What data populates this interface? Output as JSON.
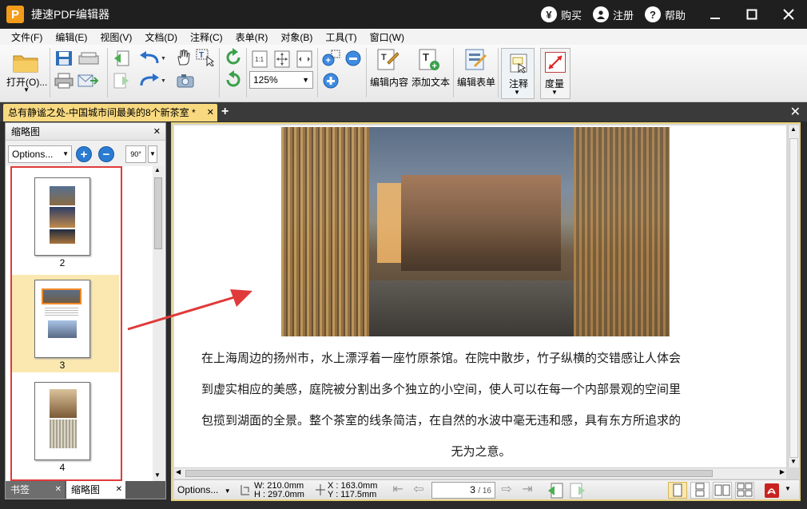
{
  "titlebar": {
    "app_title": "捷速PDF编辑器",
    "logo_letter": "P",
    "buy": "购买",
    "register": "注册",
    "help": "帮助",
    "buy_icon": "¥",
    "register_icon": "user-icon",
    "help_icon": "?"
  },
  "menu": [
    "文件(F)",
    "编辑(E)",
    "视图(V)",
    "文档(D)",
    "注释(C)",
    "表单(R)",
    "对象(B)",
    "工具(T)",
    "窗口(W)"
  ],
  "toolbar": {
    "open_label": "打开(O)...",
    "zoom_value": "125%",
    "edit_content_label": "编辑内容",
    "add_text_label": "添加文本",
    "edit_form_label": "编辑表单",
    "annotate_label": "注释",
    "measure_label": "度量"
  },
  "tabs": {
    "doc_title": "总有静谧之处-中国城市间最美的8个新茶室 *"
  },
  "left_panel": {
    "title": "缩略图",
    "options_label": "Options...",
    "rotate_label": "90°",
    "thumbnails": [
      {
        "page": "2"
      },
      {
        "page": "3"
      },
      {
        "page": "4"
      }
    ],
    "bottom_tabs": [
      "书签",
      "缩略图"
    ]
  },
  "document": {
    "paragraph_lines": [
      "在上海周边的扬州市，水上漂浮着一座竹原茶馆。在院中散步，竹子纵横的交错感让人体会",
      "到虚实相应的美感，庭院被分割出多个独立的小空间，使人可以在每一个内部景观的空间里",
      "包揽到湖面的全景。整个茶室的线条简洁，在自然的水波中毫无违和感，具有东方所追求的",
      "无为之意。"
    ]
  },
  "statusbar": {
    "options_label": "Options...",
    "width": "W: 210.0mm",
    "height": "H : 297.0mm",
    "x": "X : 163.0mm",
    "y": "Y : 117.5mm",
    "page_current": "3",
    "page_total": "/ 16"
  },
  "colors": {
    "titlebar_bg": "#1f1f1f",
    "tab_active": "#f8d980",
    "selection_red": "#e03a3a",
    "annotation_arrow": "#e03a3a"
  }
}
